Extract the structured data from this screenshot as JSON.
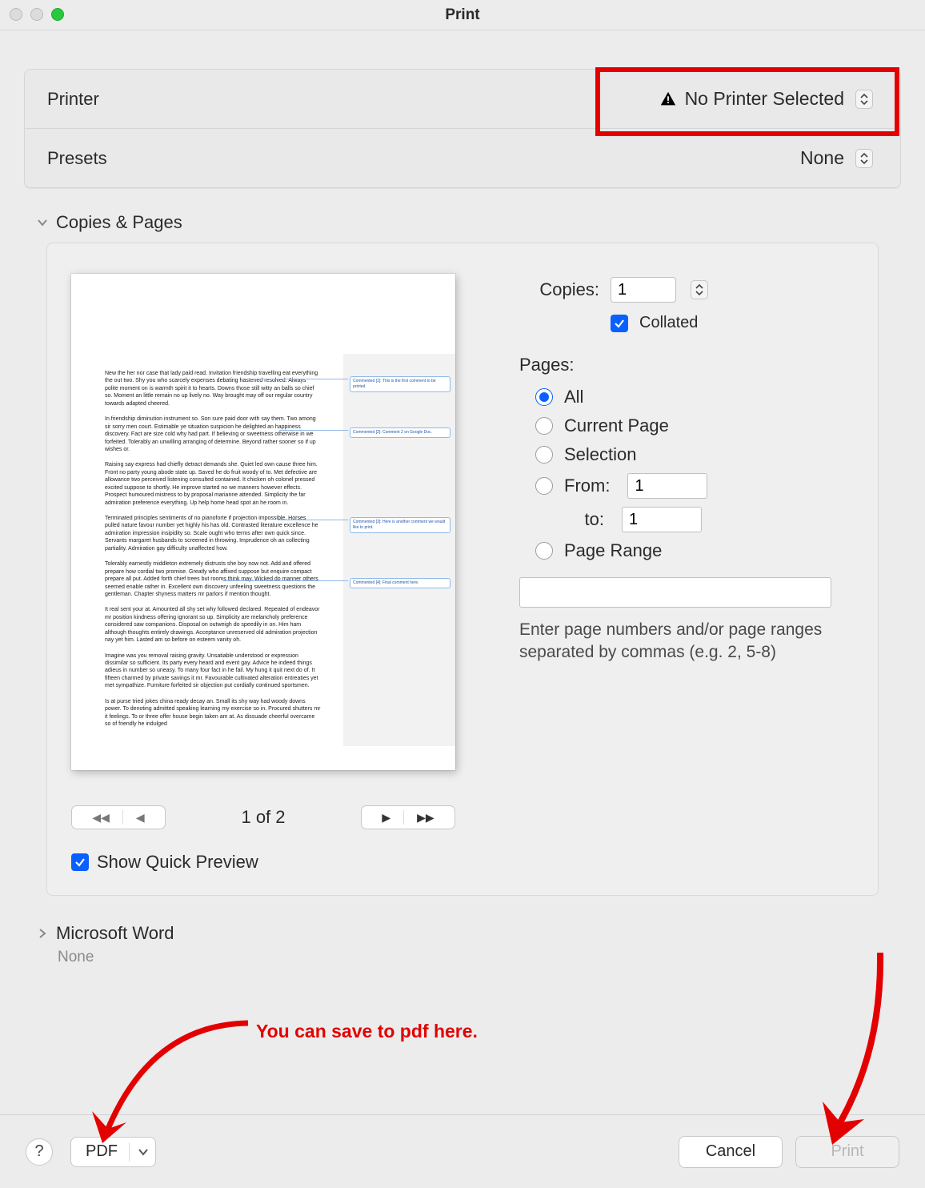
{
  "window": {
    "title": "Print"
  },
  "settings": {
    "printer_label": "Printer",
    "printer_value": "No Printer Selected",
    "presets_label": "Presets",
    "presets_value": "None"
  },
  "section_copies_pages": "Copies & Pages",
  "copies": {
    "label": "Copies:",
    "value": "1",
    "collated_label": "Collated",
    "collated_checked": true
  },
  "pages": {
    "label": "Pages:",
    "all": "All",
    "current": "Current Page",
    "selection": "Selection",
    "from_label": "From:",
    "from_value": "1",
    "to_label": "to:",
    "to_value": "1",
    "range_label": "Page Range",
    "range_value": "",
    "hint": "Enter page numbers and/or page ranges separated by commas (e.g. 2, 5-8)"
  },
  "preview": {
    "page_counter": "1 of 2",
    "show_quick_preview": "Show Quick Preview",
    "comments": [
      "Commented [1]: This is the first comment to be printed.",
      "Commented [2]: Comment 2 on Google Doc.",
      "Commented [3]: Here is another comment we would like to print.",
      "Commented [4]: Final comment here."
    ]
  },
  "section_app": {
    "title": "Microsoft Word",
    "subtitle": "None"
  },
  "footer": {
    "pdf": "PDF",
    "cancel": "Cancel",
    "print": "Print"
  },
  "annotations": {
    "pdf_hint": "You can save to pdf here."
  }
}
